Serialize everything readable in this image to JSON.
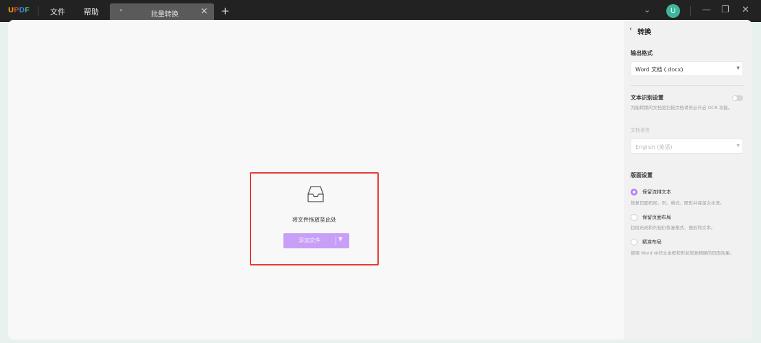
{
  "titlebar": {
    "logo": "UPDF",
    "menu": [
      "文件",
      "帮助"
    ],
    "tab": {
      "title": "批量转换",
      "close": "×",
      "dot": "•"
    },
    "add_tab": "+",
    "chevron": "⌄",
    "avatar_initial": "U",
    "controls": {
      "minimize": "—",
      "restore": "❐",
      "close": "✕"
    }
  },
  "dropzone": {
    "text": "将文件拖放至此处",
    "add_button": "添加文件",
    "border_color": "#e53935",
    "button_color": "#c79ff7"
  },
  "panel": {
    "back_icon": "‹",
    "title": "转换",
    "output_format": {
      "label": "输出格式",
      "value": "Word 文档 (.docx)"
    },
    "ocr": {
      "label": "文本识别设置",
      "enabled": false,
      "note": "为能转换的文档是扫描文档请务必开启 OCR 功能。",
      "lang_label": "文档语言",
      "lang_value": "English (英语)"
    },
    "layout": {
      "label": "版面设置",
      "options": [
        {
          "label": "保留流排文本",
          "note": "恢复页面布局、列、格式、图形并保留文本流。",
          "selected": true
        },
        {
          "label": "保留页面布局",
          "note": "拉段布局和列但仍恢复格式、图形和文本。",
          "selected": false
        },
        {
          "label": "精准布局",
          "note": "使用 Word 中的文本框和形状恢复精确的页面效果。",
          "selected": false
        }
      ]
    }
  },
  "colors": {
    "titlebar": "#222222",
    "tab_active": "#5a5a5a",
    "avatar": "#3fb69c",
    "accent": "#b882f3"
  }
}
